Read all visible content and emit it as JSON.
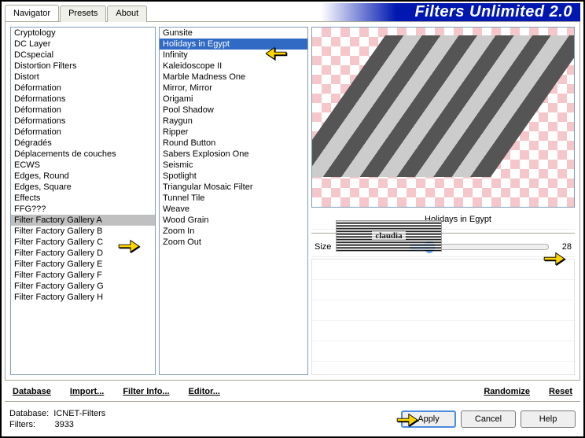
{
  "title": "Filters Unlimited 2.0",
  "tabs": [
    "Navigator",
    "Presets",
    "About"
  ],
  "activeTab": 0,
  "categories": [
    "Cryptology",
    "DC Layer",
    "DCspecial",
    "Distortion Filters",
    "Distort",
    "Déformation",
    "Déformations",
    "Déformation",
    "Déformations",
    "Déformation",
    "Dégradés",
    "Déplacements de couches",
    "ECWS",
    "Edges, Round",
    "Edges, Square",
    "Effects",
    "FFG???",
    "Filter Factory Gallery A",
    "Filter Factory Gallery B",
    "Filter Factory Gallery C",
    "Filter Factory Gallery D",
    "Filter Factory Gallery E",
    "Filter Factory Gallery F",
    "Filter Factory Gallery G",
    "Filter Factory Gallery H"
  ],
  "selectedCategoryIndex": 17,
  "filters": [
    "Gunsite",
    "Holidays in Egypt",
    "Infinity",
    "Kaleidoscope II",
    "Marble Madness One",
    "Mirror, Mirror",
    "Origami",
    "Pool Shadow",
    "Raygun",
    "Ripper",
    "Round Button",
    "Sabers Explosion One",
    "Seismic",
    "Spotlight",
    "Triangular Mosaic Filter",
    "Tunnel Tile",
    "Weave",
    "Wood Grain",
    "Zoom In",
    "Zoom Out"
  ],
  "selectedFilterIndex": 1,
  "currentFilterName": "Holidays in Egypt",
  "param": {
    "label": "Size",
    "value": "28"
  },
  "bottomButtons": {
    "database": "Database",
    "import": "Import...",
    "filterInfo": "Filter Info...",
    "editor": "Editor...",
    "randomize": "Randomize",
    "reset": "Reset"
  },
  "info": {
    "dbLabel": "Database:",
    "dbValue": "ICNET-Filters",
    "filtersLabel": "Filters:",
    "filtersValue": "3933"
  },
  "mainButtons": {
    "apply": "Apply",
    "cancel": "Cancel",
    "help": "Help"
  },
  "logoText": "claudia"
}
